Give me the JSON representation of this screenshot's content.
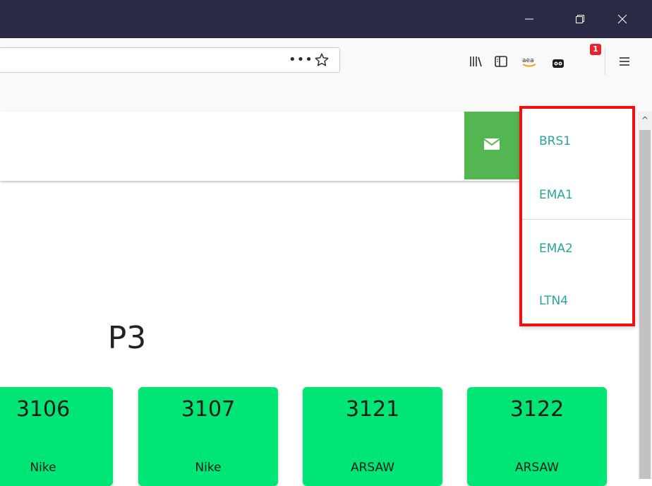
{
  "browser": {
    "window_controls": [
      "minimize",
      "restore",
      "close"
    ],
    "url_actions": {
      "more": "•••"
    },
    "toolbar_icons": [
      "library-icon",
      "sidebar-icon",
      "amazon-icon",
      "extension-icon",
      "menu-icon"
    ],
    "extension_badge": "1"
  },
  "page": {
    "title": "P3",
    "tiles": [
      {
        "number": "3106",
        "brand": "Nike"
      },
      {
        "number": "3107",
        "brand": "Nike"
      },
      {
        "number": "3121",
        "brand": "ARSAW"
      },
      {
        "number": "3122",
        "brand": "ARSAW"
      }
    ]
  },
  "dropdown": {
    "items": [
      "BRS1",
      "EMA1",
      "EMA2",
      "LTN4"
    ]
  },
  "colors": {
    "titlebar": "#2a2a46",
    "mail_button": "#53b651",
    "tile": "#00e676",
    "dropdown_text": "#26a69a",
    "highlight_border": "#ee1111"
  }
}
